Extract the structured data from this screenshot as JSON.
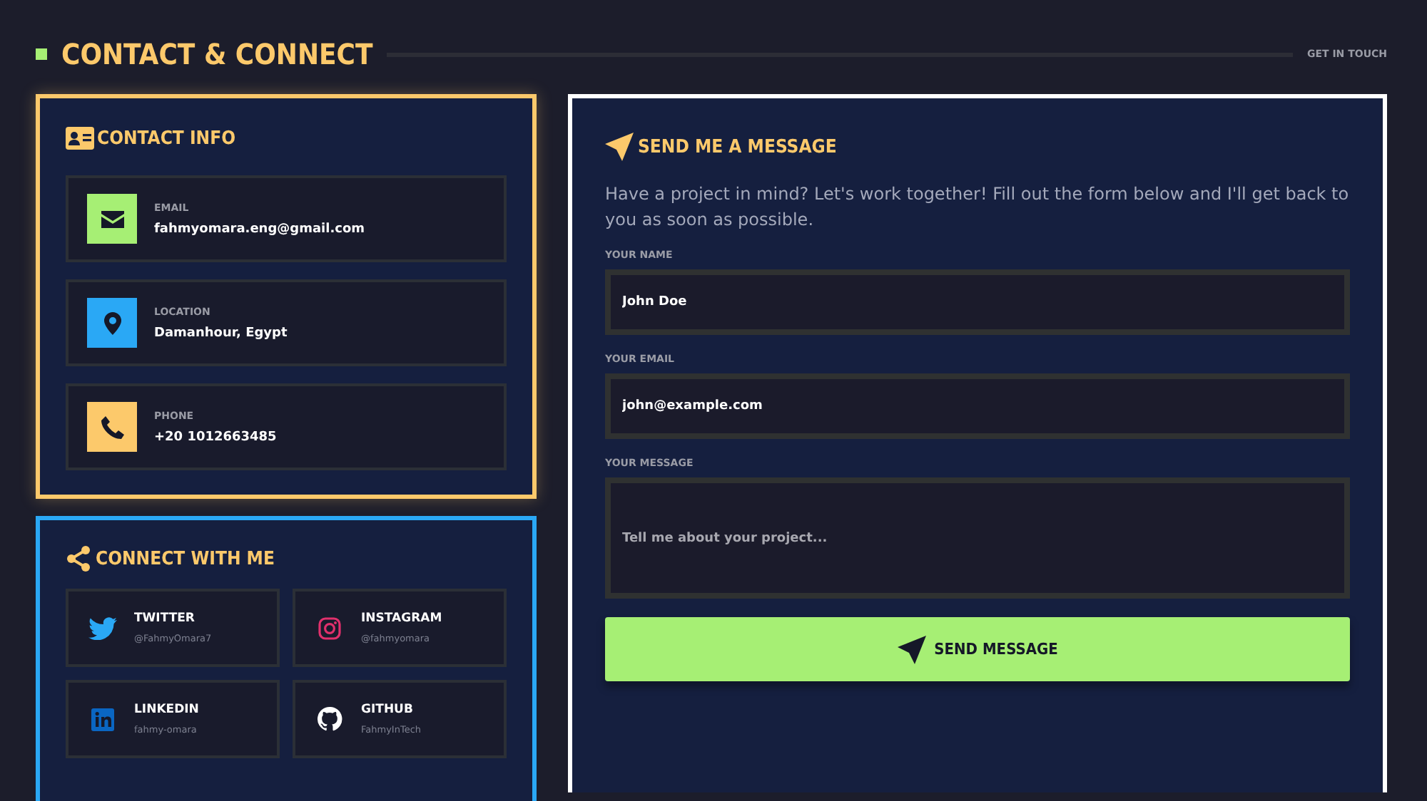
{
  "header": {
    "title": "CONTACT & CONNECT",
    "tagline": "GET IN TOUCH"
  },
  "contact_info": {
    "title": "CONTACT INFO",
    "items": [
      {
        "kind": "email",
        "label": "EMAIL",
        "value": "fahmyomara.eng@gmail.com",
        "color": "#a6ef74"
      },
      {
        "kind": "location",
        "label": "LOCATION",
        "value": "Damanhour, Egypt",
        "color": "#2aa8f5"
      },
      {
        "kind": "phone",
        "label": "PHONE",
        "value": "+20 1012663485",
        "color": "#fcc96b"
      }
    ]
  },
  "connect": {
    "title": "CONNECT WITH ME",
    "links": [
      {
        "kind": "twitter",
        "name": "TWITTER",
        "handle": "@FahmyOmara7"
      },
      {
        "kind": "instagram",
        "name": "INSTAGRAM",
        "handle": "@fahmyomara"
      },
      {
        "kind": "linkedin",
        "name": "LINKEDIN",
        "handle": "fahmy-omara"
      },
      {
        "kind": "github",
        "name": "GITHUB",
        "handle": "FahmyInTech"
      }
    ]
  },
  "message_form": {
    "title": "SEND ME A MESSAGE",
    "intro": "Have a project in mind? Let's work together! Fill out the form below and I'll get back to you as soon as possible.",
    "fields": [
      {
        "kind": "input",
        "label": "YOUR NAME",
        "value": "John Doe"
      },
      {
        "kind": "input",
        "label": "YOUR EMAIL",
        "value": "john@example.com"
      },
      {
        "kind": "textarea",
        "label": "YOUR MESSAGE",
        "placeholder": "Tell me about your project..."
      }
    ],
    "submit": "SEND MESSAGE"
  }
}
